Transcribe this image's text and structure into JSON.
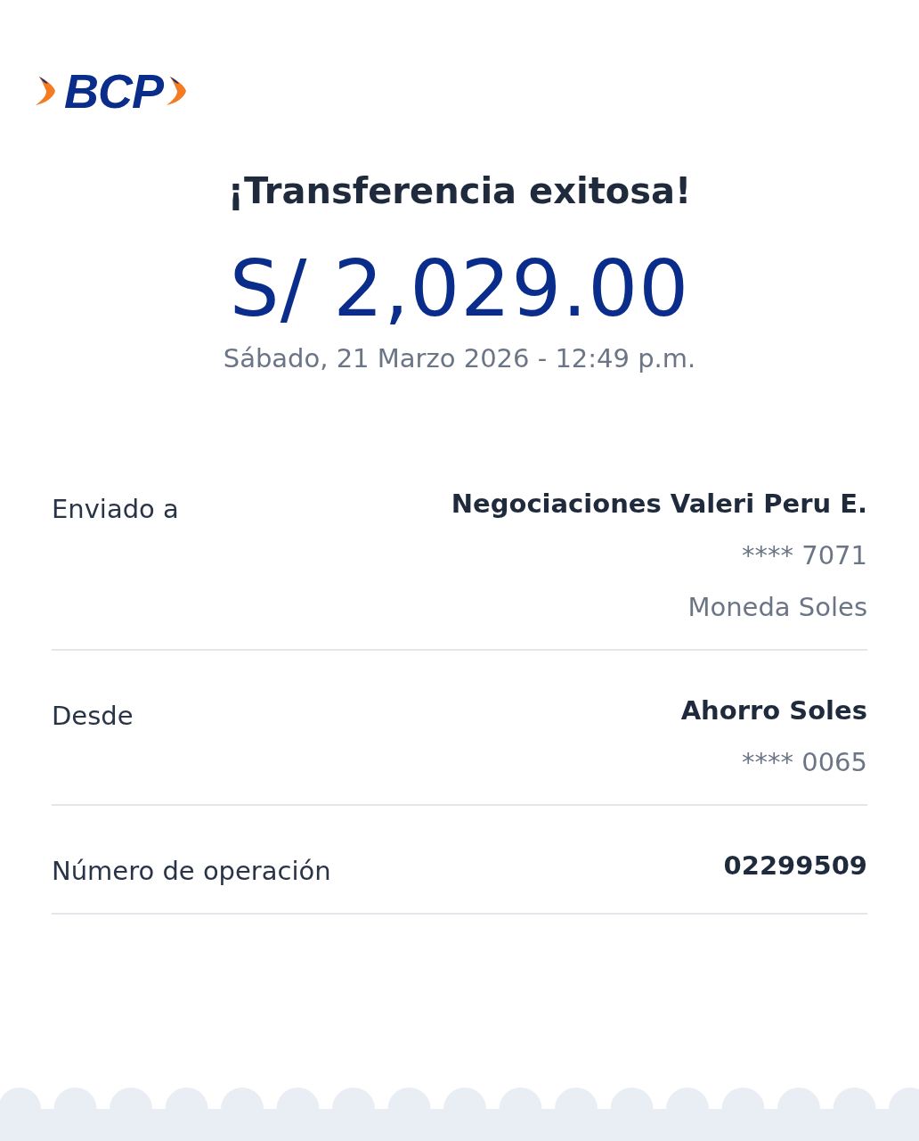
{
  "logo": {
    "text": "BCP"
  },
  "title": "¡Transferencia exitosa!",
  "amount": "S/ 2,029.00",
  "datetime": "Sábado, 21 Marzo 2026 - 12:49 p.m.",
  "details": [
    {
      "label": "Enviado a",
      "values": [
        {
          "kind": "strong",
          "text": "Negociaciones Valeri Peru E."
        },
        {
          "kind": "muted",
          "text": "**** 7071"
        },
        {
          "kind": "muted",
          "text": "Moneda Soles"
        }
      ]
    },
    {
      "label": "Desde",
      "values": [
        {
          "kind": "strong",
          "text": "Ahorro Soles"
        },
        {
          "kind": "muted",
          "text": "**** 0065"
        }
      ]
    },
    {
      "label": "Número de operación",
      "values": [
        {
          "kind": "strong",
          "text": "02299509"
        }
      ]
    }
  ]
}
